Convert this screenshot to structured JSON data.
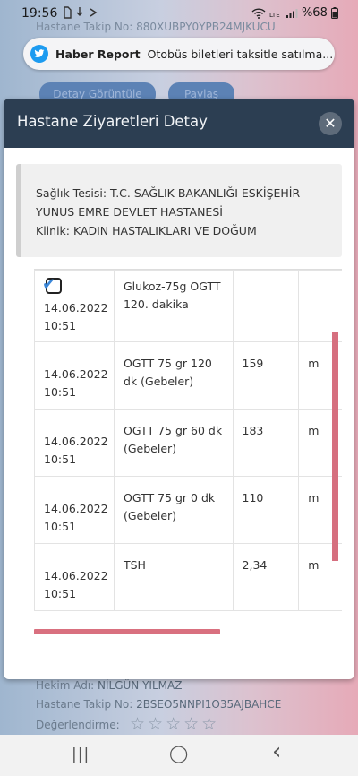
{
  "status_bar": {
    "time": "19:56",
    "battery": "%68"
  },
  "notification": {
    "source": "Haber Report",
    "message": "Otobüs biletleri taksitle satılma..."
  },
  "background": {
    "top_text": "Hastane Takip No: 880XUBPY0YPB24MJKUCU",
    "button_detail": "Detay Görüntüle",
    "button_share": "Paylaş",
    "doctor_label": "Hekim Adı:",
    "doctor_value": "NİLGÜN YILMAZ",
    "tracking_label": "Hastane Takip No:",
    "tracking_value": "2BSEO5NNPI1O35AJBAHCE",
    "rating_label": "Değerlendirme:",
    "stars": "☆☆☆☆☆"
  },
  "modal": {
    "title": "Hastane Ziyaretleri Detay",
    "close": "✕",
    "facility_line1": "Sağlık Tesisi: T.C. SAĞLIK BAKANLIĞI ESKİŞEHİR",
    "facility_line2": "YUNUS EMRE DEVLET HASTANESİ",
    "clinic_line": "Klinik: KADIN HASTALIKLARI VE DOĞUM",
    "rows": [
      {
        "date": "14.06.2022",
        "time": "10:51",
        "test": "Glukoz-75g OGTT 120. dakika",
        "value": "",
        "unit": ""
      },
      {
        "date": "14.06.2022",
        "time": "10:51",
        "test": "OGTT 75 gr 120 dk (Gebeler)",
        "value": "159",
        "unit": "m"
      },
      {
        "date": "14.06.2022",
        "time": "10:51",
        "test": "OGTT 75 gr 60 dk (Gebeler)",
        "value": "183",
        "unit": "m"
      },
      {
        "date": "14.06.2022",
        "time": "10:51",
        "test": "OGTT 75 gr 0 dk (Gebeler)",
        "value": "110",
        "unit": "m"
      },
      {
        "date": "14.06.2022",
        "time": "10:51",
        "test": "TSH",
        "value": "2,34",
        "unit": "m"
      }
    ]
  },
  "nav": {
    "recents": "|||",
    "home": "◯",
    "back": "‹"
  }
}
